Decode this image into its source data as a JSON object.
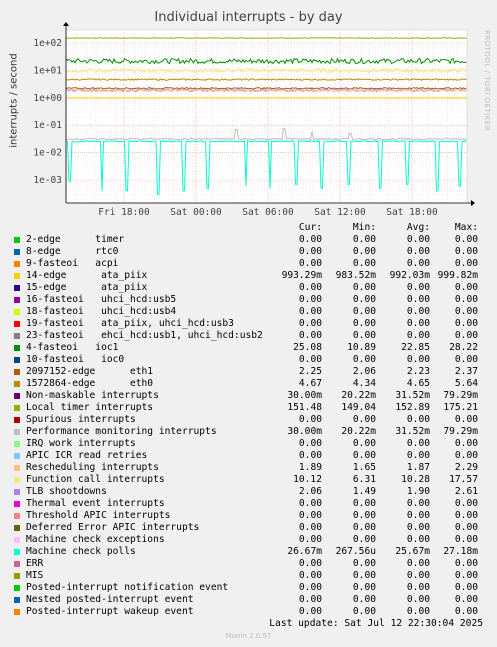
{
  "title": "Individual interrupts - by day",
  "side_text": "RRDTOOL / TOBI OETIKER",
  "footer": "Last update: Sat Jul 12 22:30:04 2025",
  "munin_version": "Munin 2.0.57",
  "columns": [
    "Cur:",
    "Min:",
    "Avg:",
    "Max:"
  ],
  "chart_data": {
    "type": "line",
    "title": "Individual interrupts - by day",
    "ylabel": "interrupts / second",
    "yscale": "log",
    "ylim": [
      0.0002,
      300
    ],
    "yticks": [
      "1e+02",
      "1e+01",
      "1e+00",
      "1e-01",
      "1e-02",
      "1e-03"
    ],
    "xticks": [
      "Fri 18:00",
      "Sat 00:00",
      "Sat 06:00",
      "Sat 12:00",
      "Sat 18:00"
    ],
    "grid": true,
    "series": [
      {
        "name": "Local timer interrupts",
        "color": "#009900",
        "cur": "151.48",
        "min": "149.04",
        "avg": "152.89",
        "max": "175.21"
      },
      {
        "name": "Non-maskable interrupts",
        "color": "#00cc00",
        "cur": "30.00m",
        "min": "20.22m",
        "avg": "31.52m",
        "max": "79.29m"
      }
    ]
  },
  "legend": [
    {
      "name": "2-edge      timer",
      "color": "#00cc00",
      "cur": "0.00",
      "min": "0.00",
      "avg": "0.00",
      "max": "0.00"
    },
    {
      "name": "8-edge      rtc0",
      "color": "#0066b3",
      "cur": "0.00",
      "min": "0.00",
      "avg": "0.00",
      "max": "0.00"
    },
    {
      "name": "9-fasteoi   acpi",
      "color": "#ff8000",
      "cur": "0.00",
      "min": "0.00",
      "avg": "0.00",
      "max": "0.00"
    },
    {
      "name": "14-edge      ata_piix",
      "color": "#ffcc00",
      "cur": "993.29m",
      "min": "983.52m",
      "avg": "992.03m",
      "max": "999.82m"
    },
    {
      "name": "15-edge      ata_piix",
      "color": "#330099",
      "cur": "0.00",
      "min": "0.00",
      "avg": "0.00",
      "max": "0.00"
    },
    {
      "name": "16-fasteoi   uhci_hcd:usb5",
      "color": "#990099",
      "cur": "0.00",
      "min": "0.00",
      "avg": "0.00",
      "max": "0.00"
    },
    {
      "name": "18-fasteoi   uhci_hcd:usb4",
      "color": "#ccff00",
      "cur": "0.00",
      "min": "0.00",
      "avg": "0.00",
      "max": "0.00"
    },
    {
      "name": "19-fasteoi   ata_piix, uhci_hcd:usb3",
      "color": "#ff0000",
      "cur": "0.00",
      "min": "0.00",
      "avg": "0.00",
      "max": "0.00"
    },
    {
      "name": "23-fasteoi   ehci_hcd:usb1, uhci_hcd:usb2",
      "color": "#808080",
      "cur": "0.00",
      "min": "0.00",
      "avg": "0.00",
      "max": "0.00"
    },
    {
      "name": "4-fasteoi   ioc1",
      "color": "#008f00",
      "cur": "25.08",
      "min": "10.89",
      "avg": "22.85",
      "max": "28.22"
    },
    {
      "name": "10-fasteoi   ioc0",
      "color": "#00487d",
      "cur": "0.00",
      "min": "0.00",
      "avg": "0.00",
      "max": "0.00"
    },
    {
      "name": "2097152-edge      eth1",
      "color": "#b35a00",
      "cur": "2.25",
      "min": "2.06",
      "avg": "2.23",
      "max": "2.37"
    },
    {
      "name": "1572864-edge      eth0",
      "color": "#b38f00",
      "cur": "4.67",
      "min": "4.34",
      "avg": "4.65",
      "max": "5.64"
    },
    {
      "name": "Non-maskable interrupts",
      "color": "#6b006b",
      "cur": "30.00m",
      "min": "20.22m",
      "avg": "31.52m",
      "max": "79.29m"
    },
    {
      "name": "Local timer interrupts",
      "color": "#8fb300",
      "cur": "151.48",
      "min": "149.04",
      "avg": "152.89",
      "max": "175.21"
    },
    {
      "name": "Spurious interrupts",
      "color": "#b30000",
      "cur": "0.00",
      "min": "0.00",
      "avg": "0.00",
      "max": "0.00"
    },
    {
      "name": "Performance monitoring interrupts",
      "color": "#bebebe",
      "cur": "30.00m",
      "min": "20.22m",
      "avg": "31.52m",
      "max": "79.29m"
    },
    {
      "name": "IRQ work interrupts",
      "color": "#80ff80",
      "cur": "0.00",
      "min": "0.00",
      "avg": "0.00",
      "max": "0.00"
    },
    {
      "name": "APIC ICR read retries",
      "color": "#80c9ff",
      "cur": "0.00",
      "min": "0.00",
      "avg": "0.00",
      "max": "0.00"
    },
    {
      "name": "Rescheduling interrupts",
      "color": "#ffc080",
      "cur": "1.89",
      "min": "1.65",
      "avg": "1.87",
      "max": "2.29"
    },
    {
      "name": "Function call interrupts",
      "color": "#ffe680",
      "cur": "10.12",
      "min": "6.31",
      "avg": "10.28",
      "max": "17.57"
    },
    {
      "name": "TLB shootdowns",
      "color": "#aa80ff",
      "cur": "2.06",
      "min": "1.49",
      "avg": "1.90",
      "max": "2.61"
    },
    {
      "name": "Thermal event interrupts",
      "color": "#ee00cc",
      "cur": "0.00",
      "min": "0.00",
      "avg": "0.00",
      "max": "0.00"
    },
    {
      "name": "Threshold APIC interrupts",
      "color": "#ff8080",
      "cur": "0.00",
      "min": "0.00",
      "avg": "0.00",
      "max": "0.00"
    },
    {
      "name": "Deferred Error APIC interrupts",
      "color": "#666600",
      "cur": "0.00",
      "min": "0.00",
      "avg": "0.00",
      "max": "0.00"
    },
    {
      "name": "Machine check exceptions",
      "color": "#ffbfff",
      "cur": "0.00",
      "min": "0.00",
      "avg": "0.00",
      "max": "0.00"
    },
    {
      "name": "Machine check polls",
      "color": "#00ffcc",
      "cur": "26.67m",
      "min": "267.56u",
      "avg": "25.67m",
      "max": "27.18m"
    },
    {
      "name": "ERR",
      "color": "#cc6699",
      "cur": "0.00",
      "min": "0.00",
      "avg": "0.00",
      "max": "0.00"
    },
    {
      "name": "MIS",
      "color": "#999900",
      "cur": "0.00",
      "min": "0.00",
      "avg": "0.00",
      "max": "0.00"
    },
    {
      "name": "Posted-interrupt notification event",
      "color": "#00cc00",
      "cur": "0.00",
      "min": "0.00",
      "avg": "0.00",
      "max": "0.00"
    },
    {
      "name": "Nested posted-interrupt event",
      "color": "#0066b3",
      "cur": "0.00",
      "min": "0.00",
      "avg": "0.00",
      "max": "0.00"
    },
    {
      "name": "Posted-interrupt wakeup event",
      "color": "#ff8000",
      "cur": "0.00",
      "min": "0.00",
      "avg": "0.00",
      "max": "0.00"
    }
  ]
}
